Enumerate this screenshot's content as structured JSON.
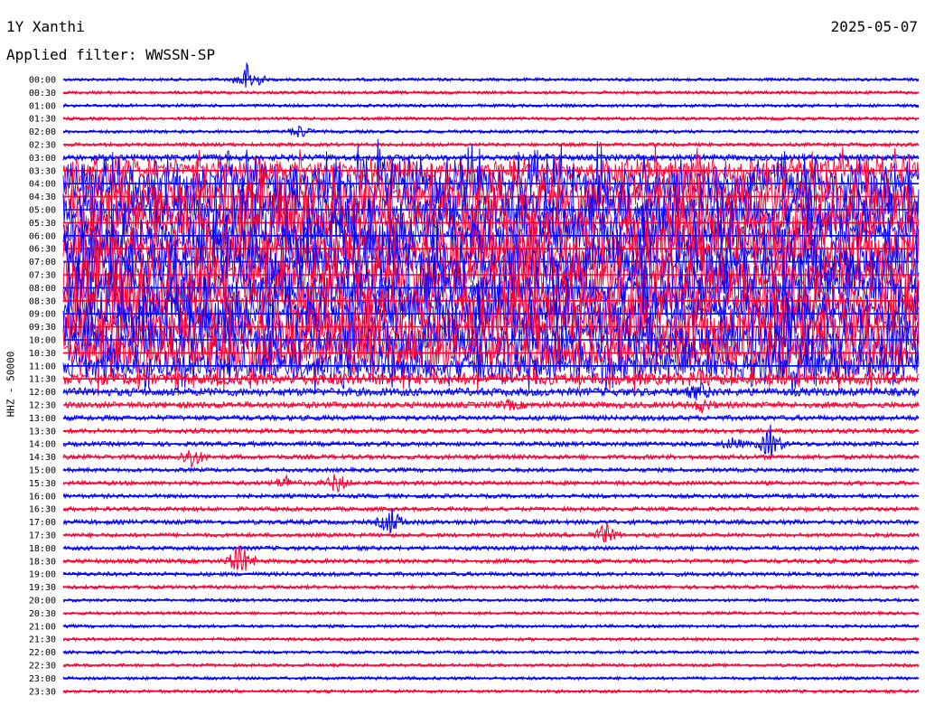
{
  "header": {
    "station": "1Y Xanthi",
    "date": "2025-05-07",
    "filter_label": "Applied filter: WWSSN-SP",
    "channel_label": "HHZ - 50000"
  },
  "colors": {
    "odd_trace": "#0000ff",
    "even_trace": "#ff0033",
    "background": "#ffffff",
    "text": "#000000"
  },
  "chart_data": {
    "type": "line",
    "title": "1Y Xanthi",
    "date": "2025-05-07",
    "filter": "WWSSN-SP",
    "ylabel": "HHZ - 50000",
    "y_tick_labels": [
      "00:00",
      "00:30",
      "01:00",
      "01:30",
      "02:00",
      "02:30",
      "03:00",
      "03:30",
      "04:00",
      "04:30",
      "05:00",
      "05:30",
      "06:00",
      "06:30",
      "07:00",
      "07:30",
      "08:00",
      "08:30",
      "09:00",
      "09:30",
      "10:00",
      "10:30",
      "11:00",
      "11:30",
      "12:00",
      "12:30",
      "13:00",
      "13:30",
      "14:00",
      "14:30",
      "15:00",
      "15:30",
      "16:00",
      "16:30",
      "17:00",
      "17:30",
      "18:00",
      "18:30",
      "19:00",
      "19:30",
      "20:00",
      "20:30",
      "21:00",
      "21:30",
      "22:00",
      "22:30",
      "23:00",
      "23:30"
    ],
    "series": [
      {
        "values": [
          0.02,
          0.02,
          0.02,
          0.02,
          0.02,
          0.03,
          0.08,
          0.45,
          0.9,
          0.95,
          0.95,
          1.0,
          1.0,
          1.0,
          1.0,
          1.0,
          1.0,
          1.0,
          1.0,
          1.0,
          1.0,
          1.0,
          0.6,
          0.2,
          0.12,
          0.08,
          0.06,
          0.05,
          0.05,
          0.05,
          0.04,
          0.04,
          0.04,
          0.04,
          0.05,
          0.04,
          0.04,
          0.04,
          0.04,
          0.03,
          0.02,
          0.02,
          0.02,
          0.02,
          0.02,
          0.02,
          0.02,
          0.02
        ]
      }
    ],
    "events": [
      {
        "row": "00:00",
        "minute": 6.5,
        "amplitude": 1.0
      },
      {
        "row": "02:00",
        "minute": 8.3,
        "amplitude": 0.35
      },
      {
        "row": "11:30",
        "minute": 22.3,
        "amplitude": 0.25
      },
      {
        "row": "12:00",
        "minute": 22.3,
        "amplitude": 0.4
      },
      {
        "row": "12:30",
        "minute": 22.4,
        "amplitude": 0.3
      },
      {
        "row": "12:30",
        "minute": 15.7,
        "amplitude": 0.2
      },
      {
        "row": "14:00",
        "minute": 24.8,
        "amplitude": 0.9
      },
      {
        "row": "14:00",
        "minute": 23.5,
        "amplitude": 0.3
      },
      {
        "row": "14:30",
        "minute": 4.5,
        "amplitude": 0.6
      },
      {
        "row": "15:30",
        "minute": 9.6,
        "amplitude": 0.55
      },
      {
        "row": "15:30",
        "minute": 7.8,
        "amplitude": 0.35
      },
      {
        "row": "17:00",
        "minute": 11.5,
        "amplitude": 0.75
      },
      {
        "row": "17:30",
        "minute": 19.0,
        "amplitude": 0.6
      },
      {
        "row": "18:30",
        "minute": 6.2,
        "amplitude": 1.0
      }
    ]
  }
}
